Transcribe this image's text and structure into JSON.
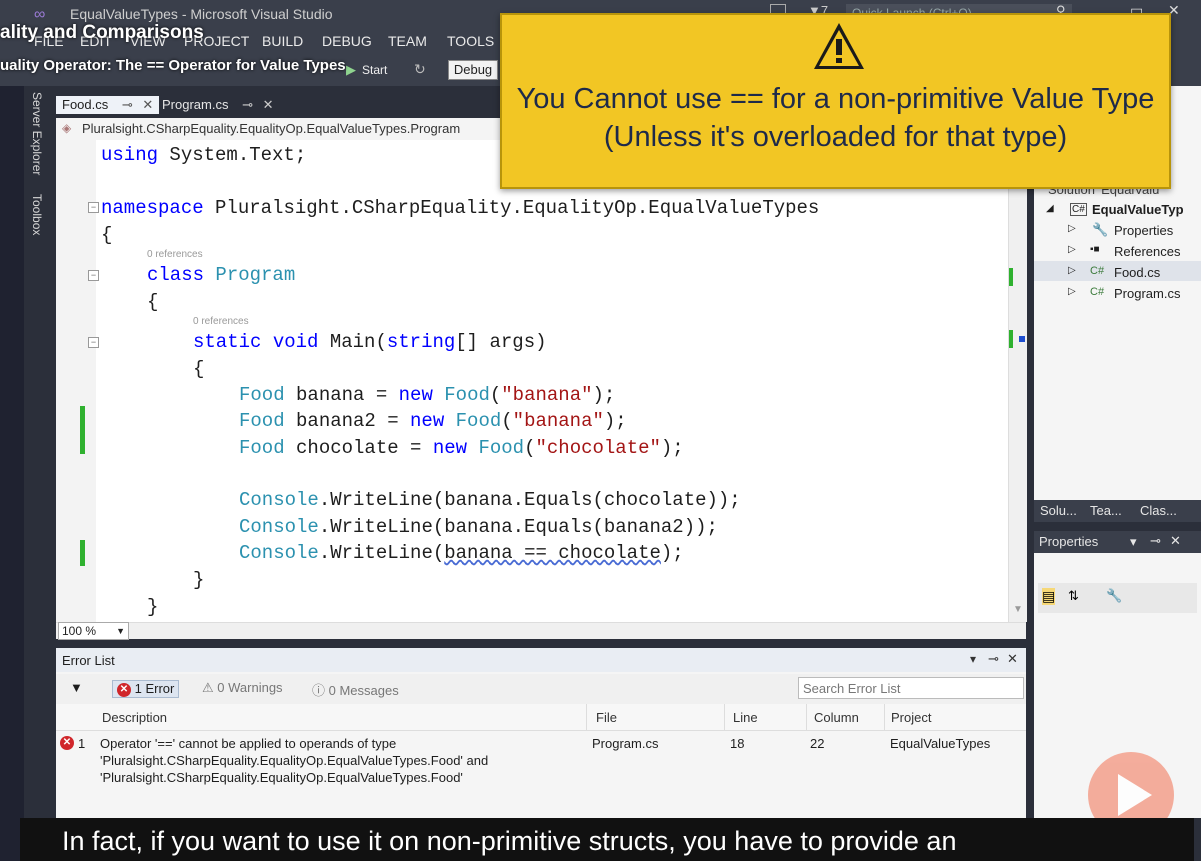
{
  "app": {
    "window_title": "EqualValueTypes - Microsoft Visual Studio",
    "quick_launch_placeholder": "Quick Launch (Ctrl+Q)",
    "menu": [
      "FILE",
      "EDIT",
      "VIEW",
      "PROJECT",
      "BUILD",
      "DEBUG",
      "TEAM",
      "TOOLS"
    ],
    "config": "Debug",
    "start_label": "Start"
  },
  "course": {
    "title": "ality and Comparisons",
    "subtitle": "uality Operator: The == Operator for Value Types"
  },
  "left_tabs": [
    "Server Explorer",
    "Toolbox"
  ],
  "doc_tabs": [
    {
      "label": "Food.cs",
      "active": true
    },
    {
      "label": "Program.cs",
      "active": false
    }
  ],
  "navbar": {
    "path": "Pluralsight.CSharpEquality.EqualityOp.EqualValueTypes.Program"
  },
  "editor": {
    "zoom": "100 %",
    "references_label": "0 references",
    "lines": [
      {
        "k1": "using",
        "rest": " System.Text;"
      },
      {
        "k1": "namespace",
        "rest": " Pluralsight.CSharpEquality.EqualityOp.EqualValueTypes"
      },
      {
        "text": "{"
      },
      {
        "k1": "class",
        "ty": " Program"
      },
      {
        "text": "{"
      },
      {
        "k1": "static",
        "k2": " void",
        "rest": " Main(",
        "k3": "string",
        "rest2": "[] args)"
      },
      {
        "text": "{"
      },
      {
        "ty": "Food",
        "rest": " banana = ",
        "kw": "new",
        "ty2": " Food",
        "rest2": "(",
        "st": "\"banana\"",
        "rest3": ");"
      },
      {
        "ty": "Food",
        "rest": " banana2 = ",
        "kw": "new",
        "ty2": " Food",
        "rest2": "(",
        "st": "\"banana\"",
        "rest3": ");"
      },
      {
        "ty": "Food",
        "rest": " chocolate = ",
        "kw": "new",
        "ty2": " Food",
        "rest2": "(",
        "st": "\"chocolate\"",
        "rest3": ");"
      },
      {
        "ty": "Console",
        "rest": ".WriteLine(banana.Equals(chocolate));"
      },
      {
        "ty": "Console",
        "rest": ".WriteLine(banana.Equals(banana2));"
      },
      {
        "ty": "Console",
        "rest": ".WriteLine(",
        "err": "banana == chocolate",
        "rest2": ");"
      },
      {
        "text": "}"
      },
      {
        "text": "}"
      }
    ]
  },
  "banner": {
    "line1": "You Cannot use == for a non-primitive Value Type",
    "line2": "(Unless it's overloaded for that type)",
    "accent": "#f2c624"
  },
  "error_list": {
    "title": "Error List",
    "errors_btn": "1 Error",
    "warnings_btn": "0 Warnings",
    "messages_btn": "0 Messages",
    "search_placeholder": "Search Error List",
    "columns": [
      "Description",
      "File",
      "Line",
      "Column",
      "Project"
    ],
    "row": {
      "index": "1",
      "desc1": "Operator '==' cannot be applied to operands of type",
      "desc2": "'Pluralsight.CSharpEquality.EqualityOp.EqualValueTypes.Food' and",
      "desc3": "'Pluralsight.CSharpEquality.EqualityOp.EqualValueTypes.Food'",
      "file": "Program.cs",
      "line": "18",
      "column": "22",
      "project": "EqualValueTypes"
    }
  },
  "solution": {
    "root": "Solution 'EqualValu",
    "project": "EqualValueTyp",
    "items": [
      "Properties",
      "References",
      "Food.cs",
      "Program.cs"
    ],
    "tabs": [
      "Solu...",
      "Tea...",
      "Clas..."
    ]
  },
  "properties": {
    "title": "Properties"
  },
  "caption": {
    "text": "In fact, if you want to use it on non-primitive structs, you have to provide an"
  }
}
